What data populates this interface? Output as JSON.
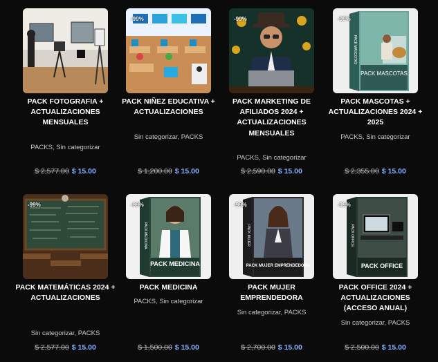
{
  "products": [
    {
      "badge": "",
      "title": "PACK FOTOGRAFIA + ACTUALIZACIONES MENSUALES",
      "categories": "PACKS, Sin categorizar",
      "old_price": "$ 2,577.00",
      "new_price": "$ 15.00"
    },
    {
      "badge": "-99%",
      "title": "PACK NIÑEZ EDUCATIVA + ACTUALIZACIONES",
      "categories": "Sin categorizar, PACKS",
      "old_price": "$ 1,200.00",
      "new_price": "$ 15.00"
    },
    {
      "badge": "-99%",
      "title": "PACK MARKETING DE AFILIADOS 2024 + ACTUALIZACIONES MENSUALES",
      "categories": "PACKS, Sin categorizar",
      "old_price": "$ 2,590.00",
      "new_price": "$ 15.00"
    },
    {
      "badge": "-99%",
      "title": "PACK MASCOTAS + ACTUALIZACIONES 2024 + 2025",
      "categories": "PACKS, Sin categorizar",
      "old_price": "$ 2,355.00",
      "new_price": "$ 15.00",
      "box_label": "PACK MASCOTAS",
      "spine_label": "PACK MASCOTAS"
    },
    {
      "badge": "-99%",
      "title": "PACK MATEMÁTICAS 2024 + ACTUALIZACIONES",
      "categories": "Sin categorizar, PACKS",
      "old_price": "$ 2,577.00",
      "new_price": "$ 15.00"
    },
    {
      "badge": "-99%",
      "title": "PACK MEDICINA",
      "categories": "PACKS, Sin categorizar",
      "old_price": "$ 1,500.00",
      "new_price": "$ 15.00",
      "box_label": "PACK MEDICINA",
      "spine_label": "PACK MEDICINA"
    },
    {
      "badge": "-99%",
      "title": "PACK MUJER EMPRENDEDORA",
      "categories": "Sin categorizar, PACKS",
      "old_price": "$ 2,700.00",
      "new_price": "$ 15.00",
      "box_label": "PACK MUJER EMPRENDEDORA",
      "spine_label": "PACK MUJER"
    },
    {
      "badge": "-99%",
      "title": "PACK OFFICE 2024 + ACTUALIZACIONES (ACCESO ANUAL)",
      "categories": "Sin categorizar, PACKS",
      "old_price": "$ 2,500.00",
      "new_price": "$ 15.00",
      "box_label": "PACK OFFICE",
      "spine_label": "PACK OFFICE"
    }
  ]
}
